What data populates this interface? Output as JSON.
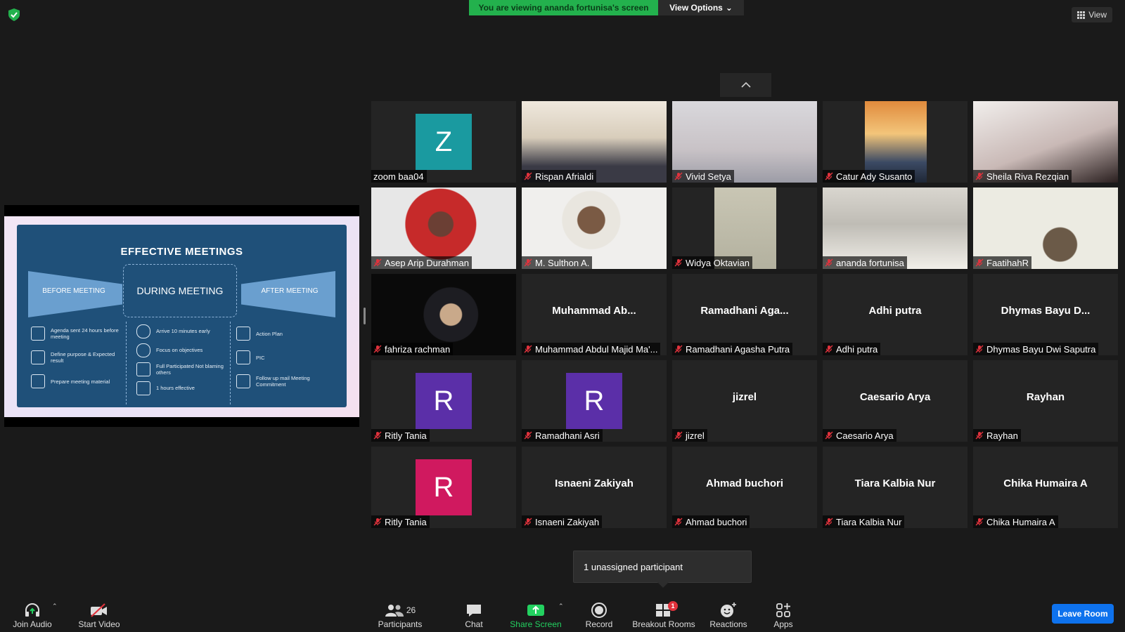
{
  "header": {
    "viewing_text": "You are viewing ananda fortunisa's screen",
    "view_options_label": "View Options",
    "view_label": "View"
  },
  "shared_slide": {
    "title": "EFFECTIVE MEETINGS",
    "before": "BEFORE MEETING",
    "during": "DURING MEETING",
    "after": "AFTER MEETING",
    "before_items": [
      "Agenda sent 24 hours before meeting",
      "Define purpose & Expected result",
      "Prepare meeting material"
    ],
    "during_items": [
      "Arrive 10 minutes early",
      "Focus on objectives",
      "Full Participated Not blaming others",
      "1 hours effective"
    ],
    "after_items": [
      "Action Plan",
      "PIC",
      "Follow up mail Meeting Commitment"
    ]
  },
  "participants": [
    {
      "name": "zoom baa04",
      "avatar": "Z",
      "avatar_color": "#1a9aa0",
      "muted": false
    },
    {
      "name": "Rispan Afrialdi",
      "video": true,
      "muted": true
    },
    {
      "name": "Vivid Setya",
      "video": true,
      "muted": true
    },
    {
      "name": "Catur Ady Susanto",
      "video": true,
      "muted": true
    },
    {
      "name": "Sheila Riva Rezqian",
      "video": true,
      "muted": true
    },
    {
      "name": "Asep Arip Durahman",
      "video": true,
      "muted": true
    },
    {
      "name": "M. Sulthon A.",
      "video": true,
      "muted": true
    },
    {
      "name": "Widya Oktavian",
      "video": true,
      "muted": true
    },
    {
      "name": "ananda fortunisa",
      "video": true,
      "muted": true,
      "active": true
    },
    {
      "name": "FaatihahR",
      "video": true,
      "muted": true
    },
    {
      "name": "fahriza rachman",
      "video": true,
      "muted": true
    },
    {
      "name": "Muhammad Abdul Majid Ma'...",
      "center": "Muhammad  Ab...",
      "muted": true
    },
    {
      "name": "Ramadhani Agasha Putra",
      "center": "Ramadhani  Aga...",
      "muted": true
    },
    {
      "name": "Adhi putra",
      "center": "Adhi putra",
      "muted": true
    },
    {
      "name": "Dhymas Bayu Dwi Saputra",
      "center": "Dhymas Bayu D...",
      "muted": true
    },
    {
      "name": "Ritly Tania",
      "avatar": "R",
      "avatar_color": "#5b2fa8",
      "muted": true
    },
    {
      "name": "Ramadhani Asri",
      "avatar": "R",
      "avatar_color": "#5b2fa8",
      "muted": true
    },
    {
      "name": "jizrel",
      "center": "jizrel",
      "muted": true
    },
    {
      "name": "Caesario Arya",
      "center": "Caesario Arya",
      "muted": true
    },
    {
      "name": "Rayhan",
      "center": "Rayhan",
      "muted": true
    },
    {
      "name": "Ritly Tania",
      "avatar": "R",
      "avatar_color": "#d0195f",
      "muted": true
    },
    {
      "name": "Isnaeni Zakiyah",
      "center": "Isnaeni Zakiyah",
      "muted": true
    },
    {
      "name": "Ahmad buchori",
      "center": "Ahmad buchori",
      "muted": true
    },
    {
      "name": "Tiara Kalbia Nur",
      "center": "Tiara Kalbia Nur",
      "muted": true
    },
    {
      "name": "Chika Humaira A",
      "center": "Chika Humaira A",
      "muted": true
    }
  ],
  "popup": {
    "text": "1 unassigned participant"
  },
  "toolbar": {
    "join_audio": "Join Audio",
    "start_video": "Start Video",
    "participants": "Participants",
    "participants_count": "26",
    "chat": "Chat",
    "share_screen": "Share Screen",
    "record": "Record",
    "breakout_rooms": "Breakout Rooms",
    "breakout_badge": "1",
    "reactions": "Reactions",
    "apps": "Apps",
    "leave_room": "Leave Room"
  },
  "colors": {
    "accent_green": "#23b14d",
    "leave_blue": "#0e72ed",
    "active_speaker": "#d8ef7a",
    "muted_red": "#e0323c"
  }
}
